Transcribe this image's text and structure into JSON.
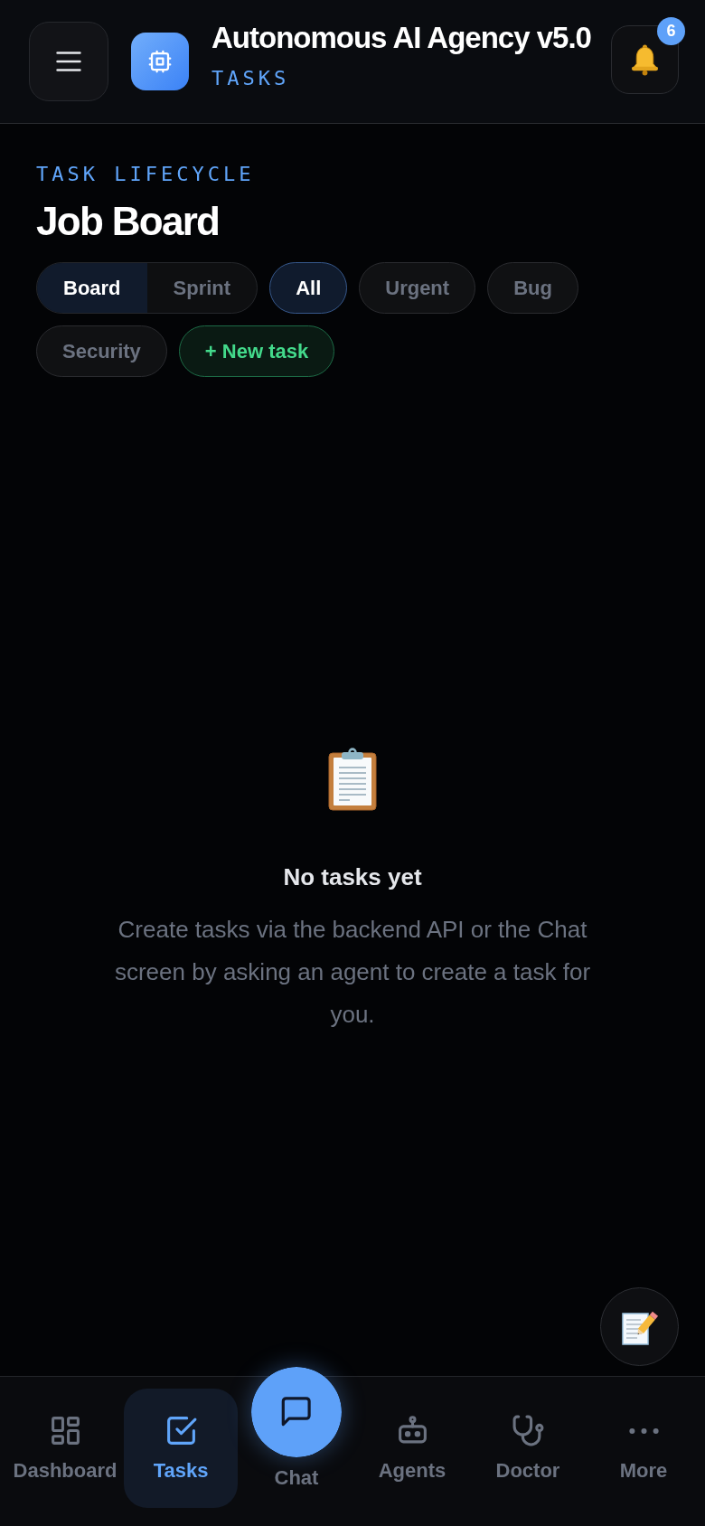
{
  "header": {
    "title": "Autonomous AI Agency v5.0",
    "subtitle": "TASKS",
    "notification_count": "6"
  },
  "page": {
    "eyebrow": "TASK LIFECYCLE",
    "title": "Job Board"
  },
  "view_tabs": [
    {
      "label": "Board",
      "selected": true
    },
    {
      "label": "Sprint",
      "selected": false
    }
  ],
  "filters": [
    {
      "label": "All",
      "selected": true
    },
    {
      "label": "Urgent",
      "selected": false
    },
    {
      "label": "Bug",
      "selected": false
    },
    {
      "label": "Security",
      "selected": false
    }
  ],
  "new_task_button": {
    "label": "+ New task"
  },
  "empty_state": {
    "title": "No tasks yet",
    "message": "Create tasks via the backend API or the Chat screen by asking an agent to create a task for you."
  },
  "bottom_nav": [
    {
      "label": "Dashboard",
      "kind": "tab",
      "selected": false
    },
    {
      "label": "Tasks",
      "kind": "tab",
      "selected": true
    },
    {
      "label": "Chat",
      "kind": "raised",
      "selected": false
    },
    {
      "label": "Agents",
      "kind": "tab",
      "selected": false
    },
    {
      "label": "Doctor",
      "kind": "tab",
      "selected": false
    },
    {
      "label": "More",
      "kind": "tab",
      "selected": false
    }
  ]
}
